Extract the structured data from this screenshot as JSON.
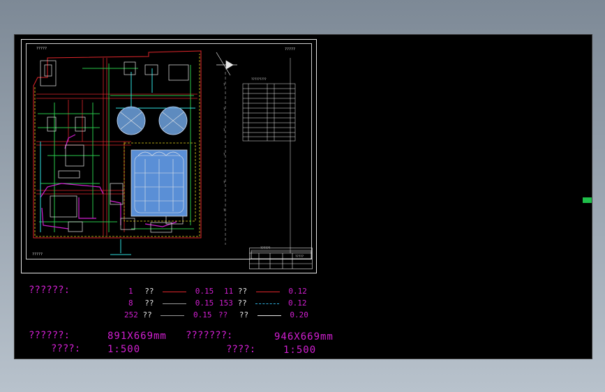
{
  "drawing": {
    "top_left_caption": "?????",
    "top_right_caption": "?????",
    "bottom_left_caption": "?????",
    "table_header": "?????????",
    "title_block_label": "??????",
    "title_block_name": "?????"
  },
  "notes": {
    "linewidth_label": "??????:",
    "rows": [
      {
        "c1": "1",
        "t1": "??",
        "v1": "0.15",
        "c2": "11",
        "t2": "??",
        "v2": "0.12",
        "col1": "#e0262b",
        "col2": "#e0262b"
      },
      {
        "c1": "8",
        "t1": "??",
        "v1": "0.15",
        "c2": "153",
        "t2": "??",
        "v2": "0.12",
        "col1": "#9a9a9a",
        "col2": "#2fb0e0"
      },
      {
        "c1": "252",
        "t1": "??",
        "v1": "0.15",
        "c2": "??",
        "t2": "??",
        "v2": "0.20",
        "col1": "#9a9a9a",
        "col2": "#e8e8e8"
      }
    ],
    "size_label_1": "??????:",
    "size_value_1": "891X669mm",
    "size_label_2": "???????:",
    "size_value_2": "946X669mm",
    "scale_label_1": "????:",
    "scale_value_1": "1:500",
    "scale_label_2": "????:",
    "scale_value_2": "1:500"
  },
  "colors": {
    "background": "#000000",
    "magenta": "#d21fd2",
    "green": "#27c94a",
    "red": "#e0262b",
    "yellow": "#e5d31b",
    "cyan": "#2fe0e0",
    "blue_fill": "#5a8fd6"
  }
}
